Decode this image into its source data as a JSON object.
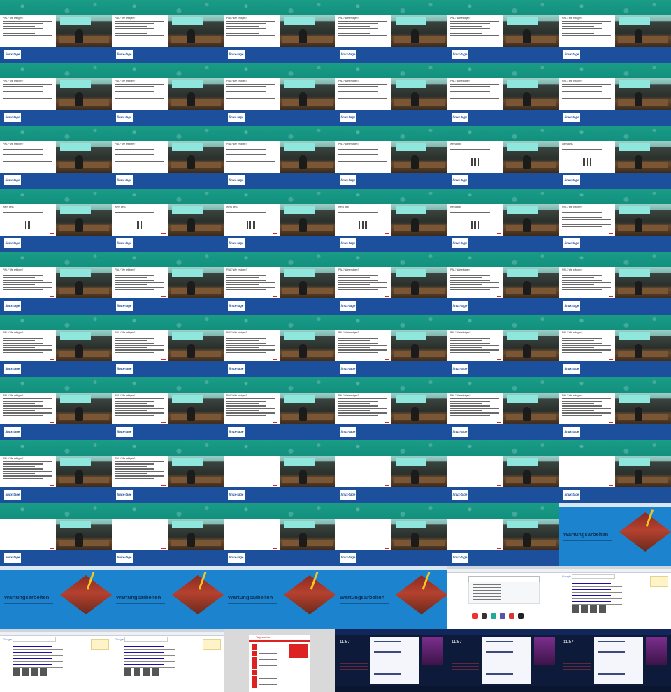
{
  "grid": {
    "cols": 6,
    "tiles": [
      {
        "kind": "talk",
        "slide": "list"
      },
      {
        "kind": "talk",
        "slide": "list"
      },
      {
        "kind": "talk",
        "slide": "list"
      },
      {
        "kind": "talk",
        "slide": "list"
      },
      {
        "kind": "talk",
        "slide": "list"
      },
      {
        "kind": "talk",
        "slide": "list"
      },
      {
        "kind": "talk",
        "slide": "list"
      },
      {
        "kind": "talk",
        "slide": "list"
      },
      {
        "kind": "talk",
        "slide": "list"
      },
      {
        "kind": "talk",
        "slide": "list"
      },
      {
        "kind": "talk",
        "slide": "list"
      },
      {
        "kind": "talk",
        "slide": "list"
      },
      {
        "kind": "talk",
        "slide": "list"
      },
      {
        "kind": "talk",
        "slide": "list"
      },
      {
        "kind": "talk",
        "slide": "list"
      },
      {
        "kind": "talk",
        "slide": "list"
      },
      {
        "kind": "talk",
        "slide": "qr"
      },
      {
        "kind": "talk",
        "slide": "qr"
      },
      {
        "kind": "talk",
        "slide": "qr"
      },
      {
        "kind": "talk",
        "slide": "qr"
      },
      {
        "kind": "talk",
        "slide": "qr"
      },
      {
        "kind": "talk",
        "slide": "qr"
      },
      {
        "kind": "talk",
        "slide": "qr"
      },
      {
        "kind": "talk",
        "slide": "list"
      },
      {
        "kind": "talk",
        "slide": "list"
      },
      {
        "kind": "talk",
        "slide": "list"
      },
      {
        "kind": "talk",
        "slide": "list"
      },
      {
        "kind": "talk",
        "slide": "list"
      },
      {
        "kind": "talk",
        "slide": "list"
      },
      {
        "kind": "talk",
        "slide": "list"
      },
      {
        "kind": "talk",
        "slide": "list"
      },
      {
        "kind": "talk",
        "slide": "list"
      },
      {
        "kind": "talk",
        "slide": "list"
      },
      {
        "kind": "talk",
        "slide": "list"
      },
      {
        "kind": "talk",
        "slide": "list"
      },
      {
        "kind": "talk",
        "slide": "list"
      },
      {
        "kind": "talk",
        "slide": "list"
      },
      {
        "kind": "talk",
        "slide": "list"
      },
      {
        "kind": "talk",
        "slide": "list"
      },
      {
        "kind": "talk",
        "slide": "list"
      },
      {
        "kind": "talk",
        "slide": "list"
      },
      {
        "kind": "talk",
        "slide": "list"
      },
      {
        "kind": "talk",
        "slide": "list"
      },
      {
        "kind": "talk",
        "slide": "list"
      },
      {
        "kind": "talk",
        "slide": "blank"
      },
      {
        "kind": "talk",
        "slide": "blank"
      },
      {
        "kind": "talk",
        "slide": "blank"
      },
      {
        "kind": "talk",
        "slide": "blank"
      },
      {
        "kind": "talk",
        "slide": "blank"
      },
      {
        "kind": "talk",
        "slide": "blank"
      },
      {
        "kind": "talk",
        "slide": "blank"
      },
      {
        "kind": "talk",
        "slide": "blank"
      },
      {
        "kind": "talk",
        "slide": "blank"
      },
      {
        "kind": "maint"
      },
      {
        "kind": "maint"
      },
      {
        "kind": "maint"
      },
      {
        "kind": "maint"
      },
      {
        "kind": "maint"
      },
      {
        "kind": "browser"
      },
      {
        "kind": "search"
      },
      {
        "kind": "search"
      },
      {
        "kind": "search"
      },
      {
        "kind": "news"
      },
      {
        "kind": "train"
      },
      {
        "kind": "train"
      },
      {
        "kind": "train"
      }
    ]
  },
  "talk": {
    "logo_text": "linux-tage",
    "slide_title_list": "PWL? Wie erfolgen?",
    "slide_title_qr": "Wer's weiß"
  },
  "maint": {
    "title": "Wartungsarbeiten"
  },
  "search": {
    "logo": "Google"
  },
  "news": {
    "logo": "Tagesschau"
  },
  "train": {
    "time": "11:57"
  }
}
